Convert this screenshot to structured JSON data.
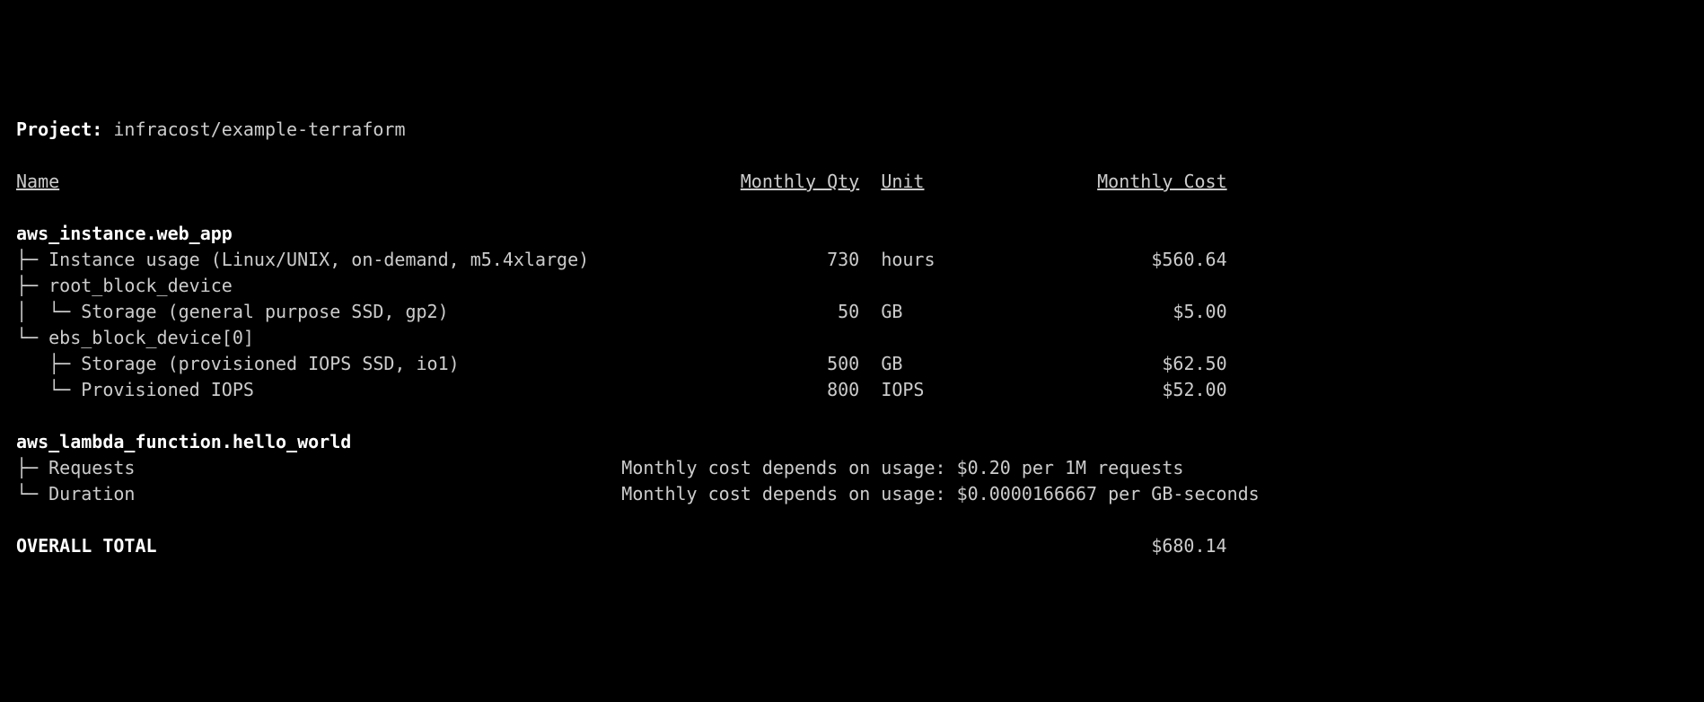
{
  "project_label": "Project:",
  "project_name": "infracost/example-terraform",
  "headers": {
    "name": "Name",
    "qty": "Monthly Qty",
    "unit": "Unit",
    "cost": "Monthly Cost"
  },
  "tree_chars": {
    "branch": "├─",
    "end": "└─",
    "nest_branch": "│   ",
    "nest_last": "    "
  },
  "resources": [
    {
      "name": "aws_instance.web_app",
      "lines": [
        {
          "prefix": "├─ ",
          "label": "Instance usage (Linux/UNIX, on-demand, m5.4xlarge)",
          "qty": "730",
          "unit": "hours",
          "cost": "$560.64"
        },
        {
          "prefix": "├─ ",
          "label": "root_block_device",
          "qty": "",
          "unit": "",
          "cost": ""
        },
        {
          "prefix": "│  └─ ",
          "label": "Storage (general purpose SSD, gp2)",
          "qty": "50",
          "unit": "GB",
          "cost": "$5.00"
        },
        {
          "prefix": "└─ ",
          "label": "ebs_block_device[0]",
          "qty": "",
          "unit": "",
          "cost": ""
        },
        {
          "prefix": "   ├─ ",
          "label": "Storage (provisioned IOPS SSD, io1)",
          "qty": "500",
          "unit": "GB",
          "cost": "$62.50"
        },
        {
          "prefix": "   └─ ",
          "label": "Provisioned IOPS",
          "qty": "800",
          "unit": "IOPS",
          "cost": "$52.00"
        }
      ]
    },
    {
      "name": "aws_lambda_function.hello_world",
      "lines": [
        {
          "prefix": "├─ ",
          "label": "Requests",
          "note": "Monthly cost depends on usage: $0.20 per 1M requests"
        },
        {
          "prefix": "└─ ",
          "label": "Duration",
          "note": "Monthly cost depends on usage: $0.0000166667 per GB-seconds"
        }
      ]
    }
  ],
  "total_label": "OVERALL TOTAL",
  "total_cost": "$680.14",
  "col": {
    "name_w": 60,
    "qty_w": 18,
    "unit_w": 8,
    "cost_w": 24
  }
}
